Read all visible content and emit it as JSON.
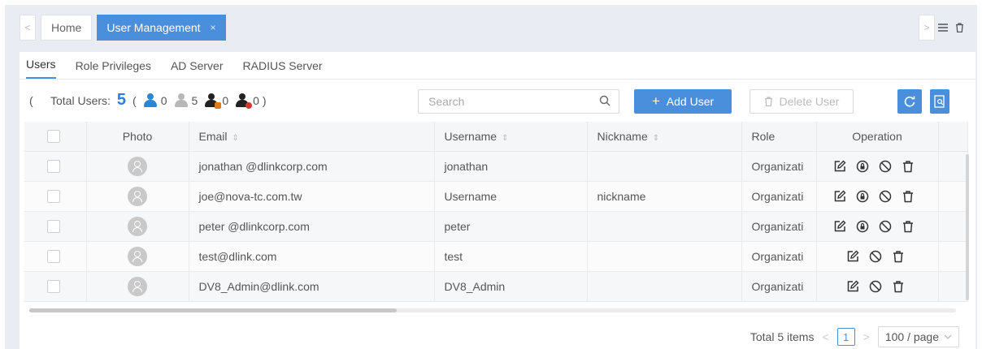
{
  "tabs": {
    "home_label": "Home",
    "active_label": "User Management",
    "active_close": "×"
  },
  "window_tools": {
    "menu_icon": "menu-icon",
    "trash_icon": "trash-icon"
  },
  "subtabs": [
    "Users",
    "Role Privileges",
    "AD Server",
    "RADIUS Server"
  ],
  "summary": {
    "collapse": "(",
    "label": "Total Users:",
    "total": "5",
    "open_paren": "(",
    "close_paren": ")",
    "counts": [
      {
        "icon": "user-blue-icon",
        "value": "0"
      },
      {
        "icon": "user-grey-icon",
        "value": "5"
      },
      {
        "icon": "user-orange-icon",
        "value": "0"
      },
      {
        "icon": "user-red-icon",
        "value": "0"
      }
    ]
  },
  "search": {
    "placeholder": "Search"
  },
  "buttons": {
    "add_user": "Add User",
    "add_prefix": "+",
    "delete_user": "Delete User"
  },
  "table": {
    "headers": {
      "photo": "Photo",
      "email": "Email",
      "username": "Username",
      "nickname": "Nickname",
      "role": "Role",
      "operation": "Operation"
    },
    "rows": [
      {
        "email": "jonathan @dlinkcorp.com",
        "username": "jonathan",
        "nickname": "",
        "role": "Organizati",
        "ops": [
          "edit",
          "unlock",
          "block",
          "delete"
        ]
      },
      {
        "email": "joe@nova-tc.com.tw",
        "username": "Username",
        "nickname": "nickname",
        "role": "Organizati",
        "ops": [
          "edit",
          "unlock",
          "block",
          "delete"
        ]
      },
      {
        "email": "peter @dlinkcorp.com",
        "username": "peter",
        "nickname": "",
        "role": "Organizati",
        "ops": [
          "edit",
          "unlock",
          "block",
          "delete"
        ]
      },
      {
        "email": "test@dlink.com",
        "username": "test",
        "nickname": "",
        "role": "Organizati",
        "ops": [
          "edit",
          "block",
          "delete"
        ]
      },
      {
        "email": "DV8_Admin@dlink.com",
        "username": "DV8_Admin",
        "nickname": "",
        "role": "Organizati",
        "ops": [
          "edit",
          "block",
          "delete"
        ]
      }
    ]
  },
  "pagination": {
    "total_label": "Total 5 items",
    "current_page": "1",
    "page_size": "100 / page",
    "prev": "<",
    "next": ">"
  },
  "colors": {
    "accent": "#4a8fdb",
    "count_blue": "#2a7fe0",
    "user_blue": "#2b87d6",
    "user_grey": "#b8b8b8",
    "user_orange": "#e07a1f",
    "user_red": "#d23b2b"
  }
}
